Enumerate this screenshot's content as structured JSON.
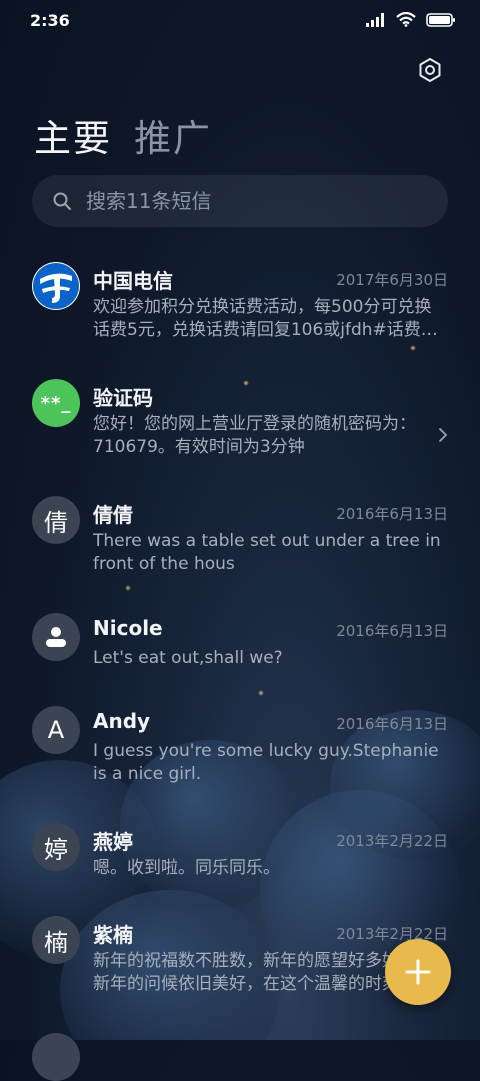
{
  "status_bar": {
    "time": "2:36",
    "icons": [
      "signal-icon",
      "wifi-icon",
      "battery-icon"
    ]
  },
  "header": {
    "settings_icon": "gear-icon",
    "tabs": [
      {
        "label": "主要",
        "active": true
      },
      {
        "label": "推广",
        "active": false
      }
    ]
  },
  "search": {
    "placeholder": "搜索11条短信",
    "value": ""
  },
  "conversations": [
    {
      "name": "中国电信",
      "date": "2017年6月30日",
      "preview": "欢迎参加积分兑换话费活动，每500分可兑换话费5元，兑换话费请回复106或jfdh#话费…",
      "avatar_type": "telecom-logo"
    },
    {
      "name": "验证码",
      "date": "",
      "preview": "您好！您的网上营业厅登录的随机密码为：710679。有效时间为3分钟",
      "avatar_text": "**_",
      "avatar_type": "green"
    },
    {
      "name": "倩倩",
      "date": "2016年6月13日",
      "preview": "There was a table set out under a tree in front of the hous",
      "avatar_text": "倩"
    },
    {
      "name": "Nicole",
      "date": "2016年6月13日",
      "preview": "Let's eat out,shall we?",
      "avatar_type": "person-icon"
    },
    {
      "name": "Andy",
      "date": "2016年6月13日",
      "preview": "I guess you're some lucky guy.Stephanie is a nice girl.",
      "avatar_text": "A"
    },
    {
      "name": "燕婷",
      "date": "2013年2月22日",
      "preview": "嗯。收到啦。同乐同乐。",
      "avatar_text": "婷"
    },
    {
      "name": "紫楠",
      "date": "2013年2月22日",
      "preview": "新年的祝福数不胜数，新年的愿望好多好多，新年的问候依旧美好，在这个温馨的时刻",
      "avatar_text": "楠"
    }
  ],
  "fab": {
    "icon": "plus-icon"
  },
  "colors": {
    "accent": "#e8b94c",
    "verify_avatar": "#4cc45a",
    "background": "#0e1829"
  }
}
